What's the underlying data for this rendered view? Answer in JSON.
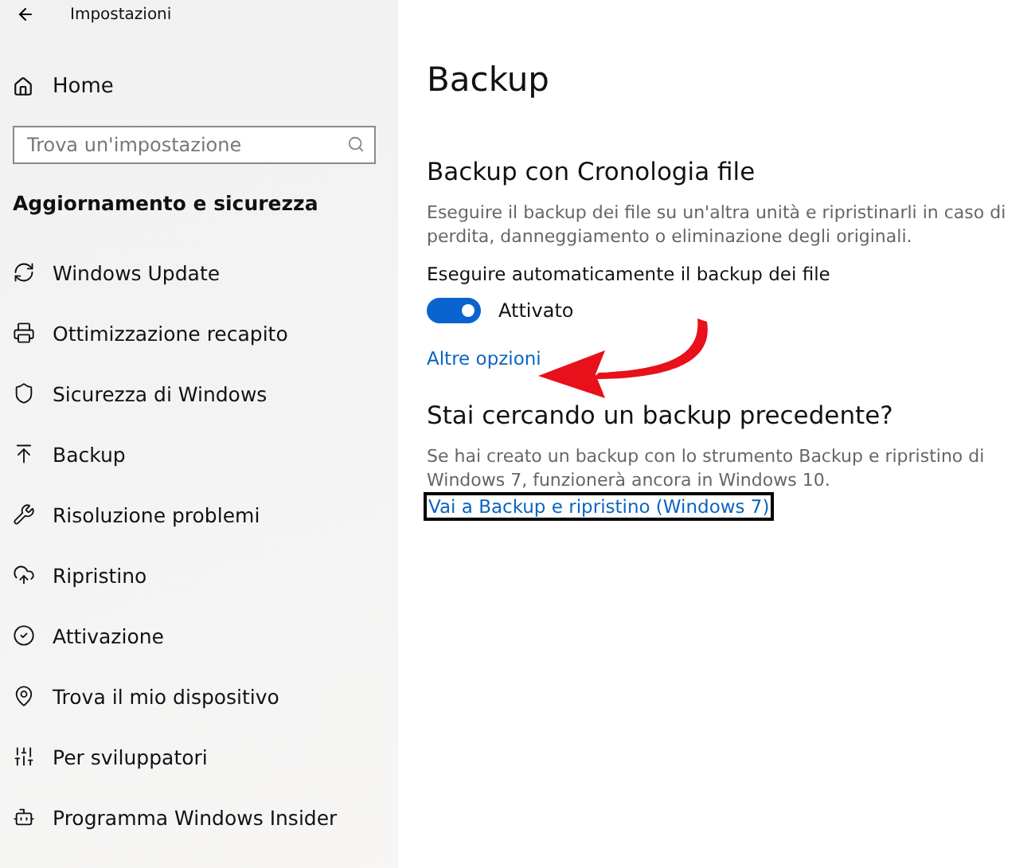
{
  "window": {
    "title": "Impostazioni"
  },
  "sidebar": {
    "home": "Home",
    "search": {
      "placeholder": "Trova un'impostazione"
    },
    "section": "Aggiornamento e sicurezza",
    "items": [
      {
        "label": "Windows Update"
      },
      {
        "label": "Ottimizzazione recapito"
      },
      {
        "label": "Sicurezza di Windows"
      },
      {
        "label": "Backup"
      },
      {
        "label": "Risoluzione problemi"
      },
      {
        "label": "Ripristino"
      },
      {
        "label": "Attivazione"
      },
      {
        "label": "Trova il mio dispositivo"
      },
      {
        "label": "Per sviluppatori"
      },
      {
        "label": "Programma Windows Insider"
      }
    ]
  },
  "main": {
    "title": "Backup",
    "history": {
      "heading": "Backup con Cronologia file",
      "description": "Eseguire il backup dei file su un'altra unità e ripristinarli in caso di perdita, danneggiamento o eliminazione degli originali.",
      "toggle_label": "Eseguire automaticamente il backup dei file",
      "toggle": {
        "on": true,
        "text": "Attivato"
      },
      "link": "Altre opzioni"
    },
    "previous": {
      "heading": "Stai cercando un backup precedente?",
      "description": "Se hai creato un backup con lo strumento Backup e ripristino di Windows 7, funzionerà ancora in Windows 10.",
      "link": "Vai a Backup e ripristino (Windows 7)"
    }
  }
}
